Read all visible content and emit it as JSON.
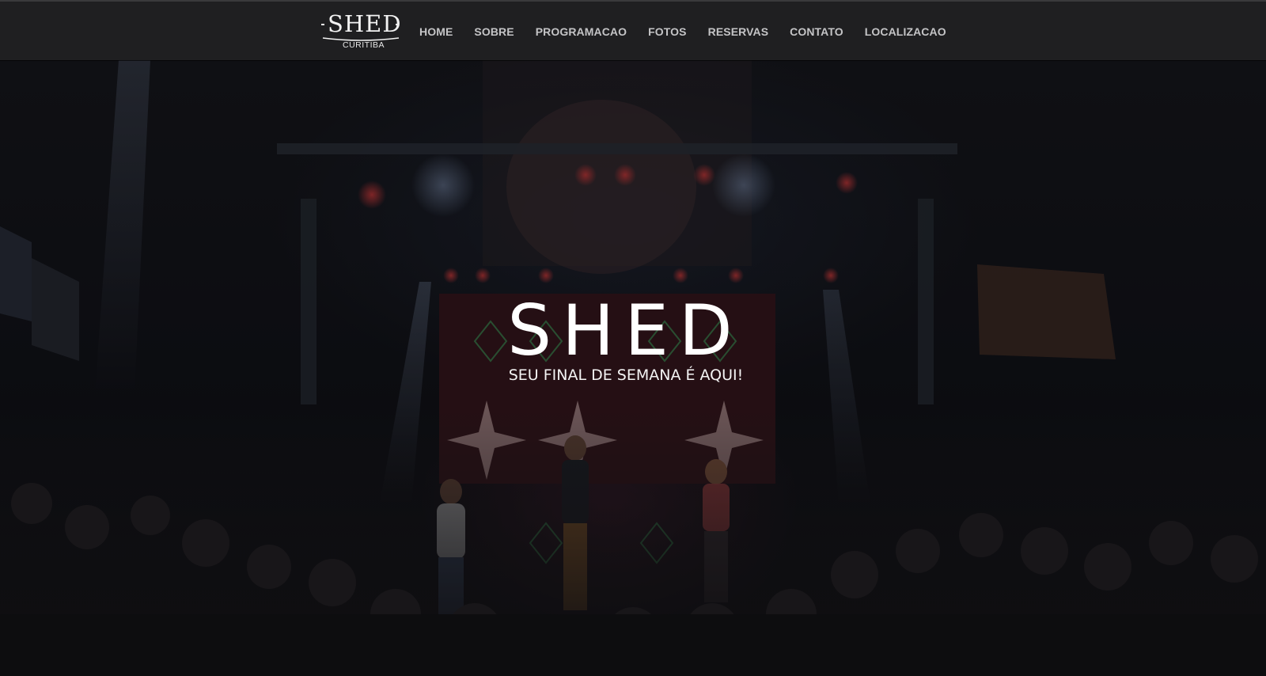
{
  "logo": {
    "wordmark": "SHED",
    "city": "CURITIBA"
  },
  "nav": {
    "items": [
      {
        "label": "HOME"
      },
      {
        "label": "SOBRE"
      },
      {
        "label": "PROGRAMACAO"
      },
      {
        "label": "FOTOS"
      },
      {
        "label": "RESERVAS"
      },
      {
        "label": "CONTATO"
      },
      {
        "label": "LOCALIZACAO"
      }
    ]
  },
  "hero": {
    "title": "SHED",
    "subtitle": "SEU FINAL DE SEMANA É AQUI!",
    "background": "concert-stage-photo"
  },
  "colors": {
    "nav_bg": "#1f1f21",
    "nav_text": "#c4c4c6",
    "hero_text": "#ffffff"
  }
}
